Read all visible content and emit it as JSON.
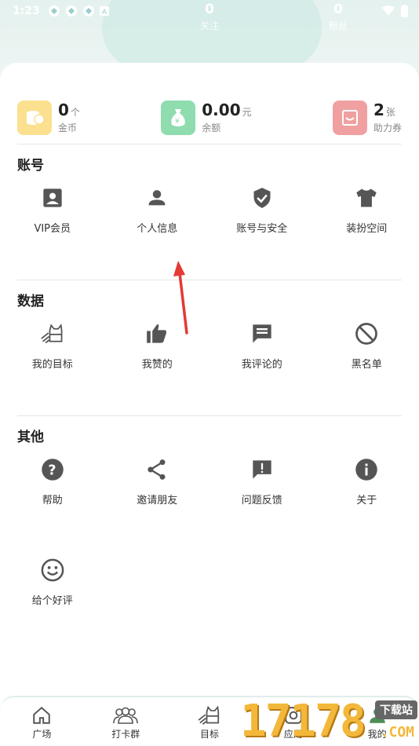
{
  "status": {
    "time": "1:23"
  },
  "header_stats": [
    {
      "num": "",
      "label": ""
    },
    {
      "num": "0",
      "label": "关注"
    },
    {
      "num": "0",
      "label": "粉丝"
    }
  ],
  "assets": [
    {
      "icon": "coins-icon",
      "value": "0",
      "unit": "个",
      "label": "金币",
      "color": "#fbe08f"
    },
    {
      "icon": "money-bag-icon",
      "value": "0.00",
      "unit": "元",
      "label": "余额",
      "color": "#8fdcae"
    },
    {
      "icon": "coupon-icon",
      "value": "2",
      "unit": "张",
      "label": "助力券",
      "color": "#f0a0a0"
    }
  ],
  "sections": {
    "account": {
      "title": "账号",
      "items": [
        {
          "label": "VIP会员",
          "icon": "vip-card-icon"
        },
        {
          "label": "个人信息",
          "icon": "person-icon"
        },
        {
          "label": "账号与安全",
          "icon": "shield-check-icon"
        },
        {
          "label": "装扮空间",
          "icon": "tshirt-icon"
        }
      ]
    },
    "data": {
      "title": "数据",
      "items": [
        {
          "label": "我的目标",
          "icon": "target-cat-icon"
        },
        {
          "label": "我赞的",
          "icon": "thumbs-up-icon"
        },
        {
          "label": "我评论的",
          "icon": "comment-icon"
        },
        {
          "label": "黑名单",
          "icon": "block-icon"
        }
      ]
    },
    "other": {
      "title": "其他",
      "items": [
        {
          "label": "帮助",
          "icon": "help-icon"
        },
        {
          "label": "邀请朋友",
          "icon": "share-icon"
        },
        {
          "label": "问题反馈",
          "icon": "feedback-icon"
        },
        {
          "label": "关于",
          "icon": "info-icon"
        },
        {
          "label": "给个好评",
          "icon": "smile-icon"
        }
      ]
    }
  },
  "bottom_nav": [
    {
      "label": "广场",
      "icon": "home-icon"
    },
    {
      "label": "打卡群",
      "icon": "group-icon"
    },
    {
      "label": "目标",
      "icon": "target-cat-icon"
    },
    {
      "label": "应用",
      "icon": "app-icon"
    },
    {
      "label": "我的",
      "icon": "profile-icon"
    }
  ],
  "watermark": {
    "digits": "17178",
    "tag": "下载站",
    "suffix": ".COM"
  },
  "colors": {
    "icon": "#555555",
    "arrow": "#e53935",
    "accent_bg": "#e9f3f1"
  }
}
